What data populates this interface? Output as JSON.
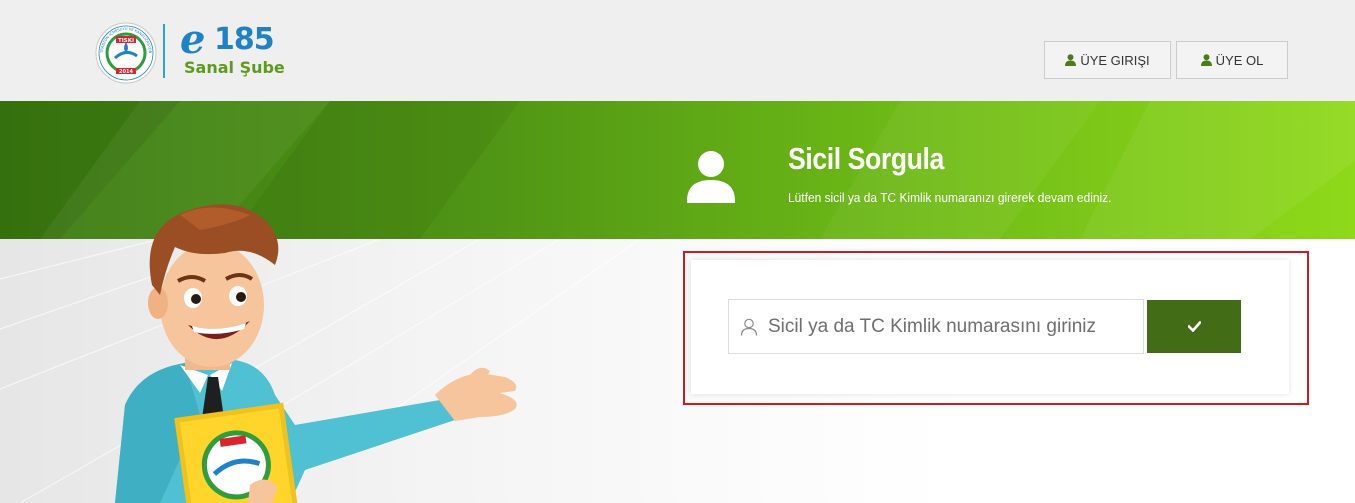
{
  "header": {
    "seal": {
      "abbr": "TISKI",
      "year": "2014",
      "ring_text": "TRABZON İÇMESUYU VE KANALİZASYON İDARESİ"
    },
    "brand": {
      "prefix": "e",
      "number": "185",
      "subtitle": "Sanal Şube"
    },
    "nav": {
      "login_label": "ÜYE GIRIŞI",
      "register_label": "ÜYE OL",
      "login_icon": "user-icon",
      "register_icon": "user-icon"
    }
  },
  "banner": {
    "title": "Sicil Sorgula",
    "subtitle": "Lütfen sicil ya da TC Kimlik numaranızı girerek devam ediniz.",
    "icon": "user-icon"
  },
  "form": {
    "input_placeholder": "Sicil ya da TC Kimlik numarasını giriniz",
    "input_value": "",
    "input_icon": "user-outline-icon",
    "submit_icon": "check-icon"
  },
  "colors": {
    "brand_blue": "#1e83c6",
    "brand_green": "#5d9a1e",
    "banner_dark": "#3a7a10",
    "banner_light": "#8fd91a",
    "submit_bg": "#436c16",
    "highlight": "#cc1a22"
  }
}
